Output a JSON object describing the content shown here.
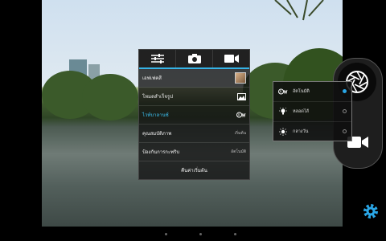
{
  "menu": {
    "tabs": [
      {
        "icon": "sliders-icon"
      },
      {
        "icon": "camera-icon"
      },
      {
        "icon": "video-camera-icon"
      }
    ],
    "rows": [
      {
        "label": "เอฟเฟคสี",
        "value": "",
        "kind": "thumbnail"
      },
      {
        "label": "โหมดสำเร็จรูป",
        "value": "",
        "kind": "image-icon"
      },
      {
        "label": "ไวท์บาลานซ์",
        "value": "",
        "kind": "awb-icon",
        "active": true
      },
      {
        "label": "คุณสมบัติภาพ",
        "value": "เริ่มต้น",
        "kind": "text"
      },
      {
        "label": "ป้องกันการกะพริบ",
        "value": "อัตโนมัติ",
        "kind": "text"
      }
    ],
    "reset_label": "คืนค่าเริ่มต้น"
  },
  "white_balance": {
    "options": [
      {
        "label": "อัตโนมัติ",
        "icon": "awb-icon",
        "selected": true
      },
      {
        "label": "หลอดไส้",
        "icon": "incandescent-icon",
        "selected": false
      },
      {
        "label": "กลางวัน",
        "icon": "daylight-icon",
        "selected": false
      }
    ]
  },
  "colors": {
    "accent": "#36b3e6",
    "active_text": "#3cc0f0"
  }
}
